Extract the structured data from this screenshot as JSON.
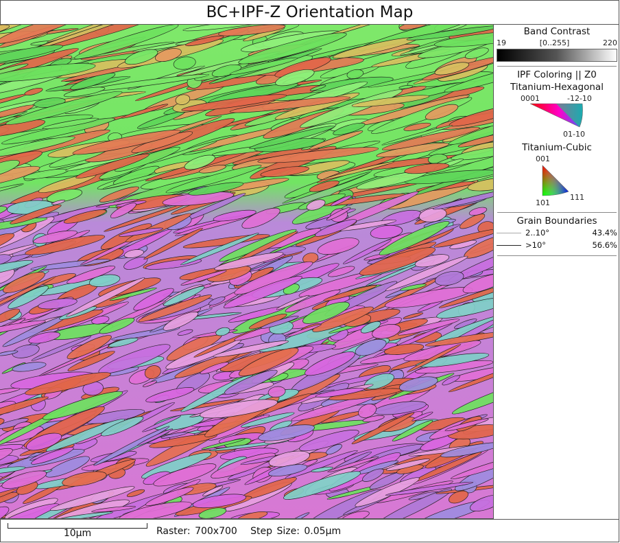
{
  "title": "BC+IPF-Z Orientation Map",
  "legend": {
    "band_contrast": {
      "title": "Band Contrast",
      "min": "19",
      "range": "[0..255]",
      "max": "220"
    },
    "ipf": {
      "title": "IPF Coloring || Z0",
      "hexagonal": {
        "title": "Titanium-Hexagonal",
        "labels": [
          "0001",
          "-12-10",
          "01-10"
        ]
      },
      "cubic": {
        "title": "Titanium-Cubic",
        "labels": [
          "001",
          "101",
          "111"
        ]
      }
    },
    "grain_boundaries": {
      "title": "Grain Boundaries",
      "items": [
        {
          "label": "2..10°",
          "value": "43.4%",
          "color": "#aaaaaa"
        },
        {
          "label": ">10°",
          "value": "56.6%",
          "color": "#222222"
        }
      ]
    }
  },
  "footer": {
    "scale_label": "10µm",
    "raster": "Raster: 700x700",
    "step": "Step Size: 0.05µm"
  },
  "colors": {
    "green": "#6ee25f",
    "red": "#e2664a",
    "magenta": "#e16fd6",
    "purple": "#b07ad8"
  }
}
